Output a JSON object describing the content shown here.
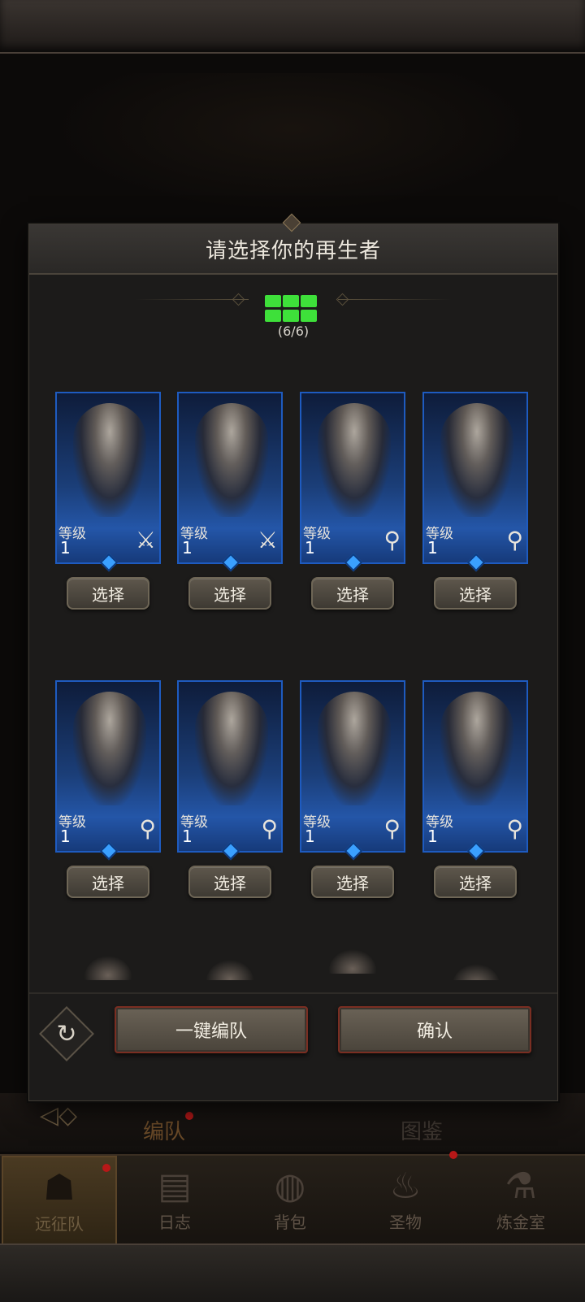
{
  "modal": {
    "title": "请选择你的再生者",
    "team_count": "(6/6)",
    "auto_team_label": "一键编队",
    "confirm_label": "确认"
  },
  "heroes": [
    {
      "level_label": "等级",
      "level": "1",
      "class_icon": "sword-icon",
      "class_glyph": "⚔",
      "select_label": "选择"
    },
    {
      "level_label": "等级",
      "level": "1",
      "class_icon": "sword-icon",
      "class_glyph": "⚔",
      "select_label": "选择"
    },
    {
      "level_label": "等级",
      "level": "1",
      "class_icon": "staff-icon",
      "class_glyph": "⚲",
      "select_label": "选择"
    },
    {
      "level_label": "等级",
      "level": "1",
      "class_icon": "staff-icon",
      "class_glyph": "⚲",
      "select_label": "选择"
    },
    {
      "level_label": "等级",
      "level": "1",
      "class_icon": "staff-icon",
      "class_glyph": "⚲",
      "select_label": "选择"
    },
    {
      "level_label": "等级",
      "level": "1",
      "class_icon": "staff-icon",
      "class_glyph": "⚲",
      "select_label": "选择"
    },
    {
      "level_label": "等级",
      "level": "1",
      "class_icon": "staff-icon",
      "class_glyph": "⚲",
      "select_label": "选择"
    },
    {
      "level_label": "等级",
      "level": "1",
      "class_icon": "staff-icon",
      "class_glyph": "⚲",
      "select_label": "选择"
    }
  ],
  "background": {
    "tabs": [
      "编队",
      "图鉴"
    ],
    "nav": [
      {
        "label": "远征队",
        "icon": "helmet-icon",
        "glyph": "☗"
      },
      {
        "label": "日志",
        "icon": "scroll-icon",
        "glyph": "▤"
      },
      {
        "label": "背包",
        "icon": "bag-icon",
        "glyph": "◍"
      },
      {
        "label": "圣物",
        "icon": "torch-icon",
        "glyph": "♨"
      },
      {
        "label": "炼金室",
        "icon": "alchemy-icon",
        "glyph": "⚗"
      }
    ]
  },
  "colors": {
    "team_indicator": "#3ee03a",
    "card_border": "#1e5bc0",
    "badge_red": "#b81818"
  }
}
